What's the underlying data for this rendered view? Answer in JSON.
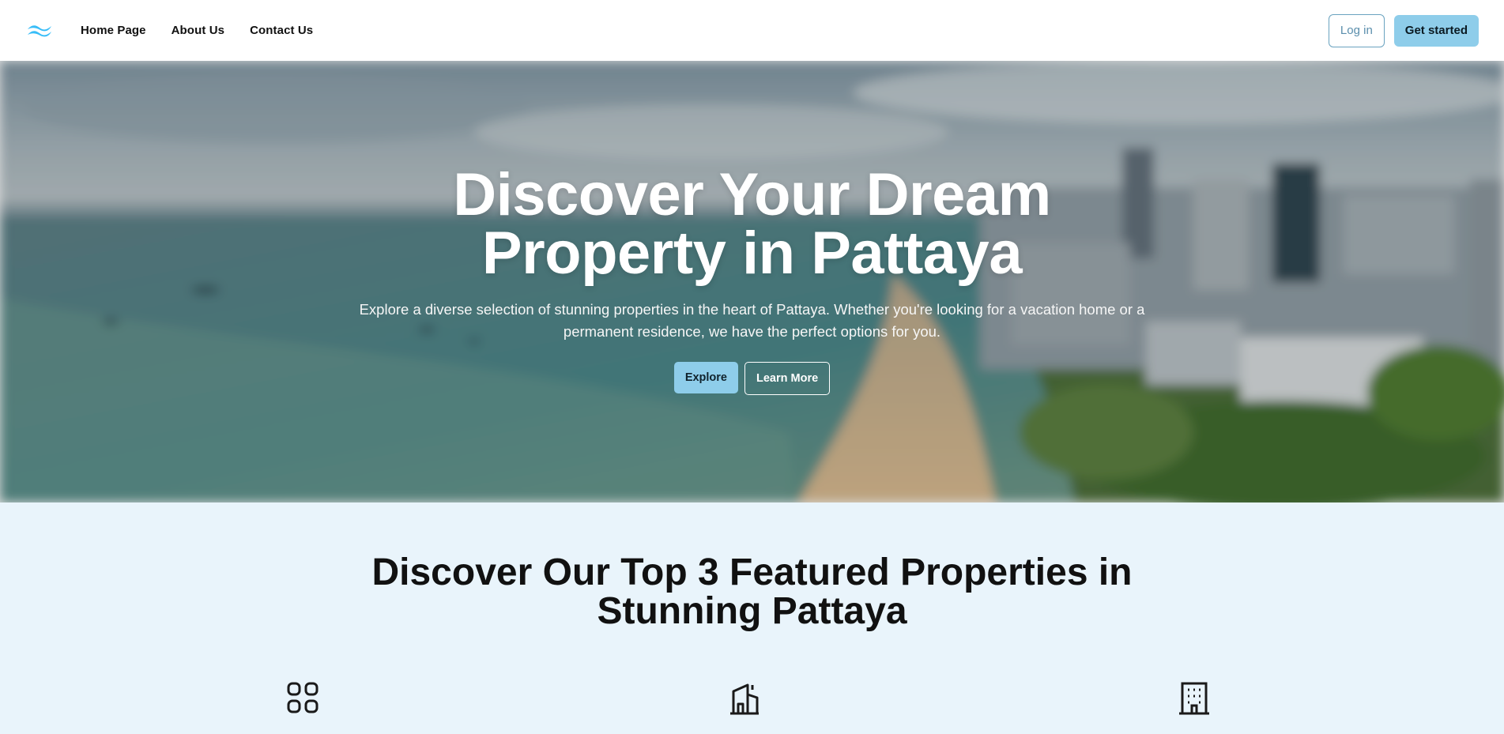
{
  "header": {
    "logo_icon": "tailwind-wave-logo-icon",
    "nav": [
      "Home Page",
      "About Us",
      "Contact Us"
    ],
    "login_label": "Log in",
    "get_started_label": "Get started"
  },
  "hero": {
    "title_line1": "Discover Your Dream",
    "title_line2": "Property in Pattaya",
    "description_line1": "Explore a diverse selection of stunning properties in the heart of Pattaya. Whether you're looking for a vacation home or a",
    "description_line2": "permanent residence, we have the perfect options for you.",
    "explore_label": "Explore",
    "learn_more_label": "Learn More"
  },
  "featured": {
    "title_line1": "Discover Our Top 3 Featured Properties in",
    "title_line2": "Stunning Pattaya",
    "icons": [
      "grid-icon",
      "house-icon",
      "building-icon"
    ]
  },
  "colors": {
    "accent": "#8ecdea",
    "login_border": "#6aa3c0",
    "featured_bg": "#e9f4fb"
  }
}
